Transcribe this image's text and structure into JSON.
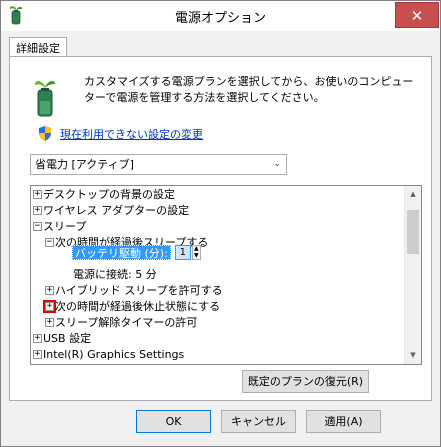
{
  "window": {
    "title": "電源オプション",
    "close_glyph": "✕"
  },
  "tab": {
    "label": "詳細設定"
  },
  "description": "カスタマイズする電源プランを選択してから、お使いのコンピューターで電源を管理する方法を選択してください。",
  "change_link": "現在利用できない設定の変更",
  "plan_select": {
    "value": "省電力 [アクティブ]",
    "arrow": "⌄"
  },
  "tree": {
    "items": [
      {
        "expander": "+",
        "label": "デスクトップの背景の設定"
      },
      {
        "expander": "+",
        "label": "ワイヤレス アダプターの設定"
      },
      {
        "expander": "−",
        "label": "スリープ"
      },
      {
        "expander": "−",
        "label": "次の時間が経過後スリープする"
      },
      {
        "expander": "",
        "label": "電源に接続: 5 分"
      },
      {
        "expander": "+",
        "label": "ハイブリッド スリープを許可する"
      },
      {
        "expander": "+",
        "label": "次の時間が経過後休止状態にする"
      },
      {
        "expander": "+",
        "label": "スリープ解除タイマーの許可"
      },
      {
        "expander": "+",
        "label": "USB 設定"
      },
      {
        "expander": "+",
        "label": "Intel(R) Graphics Settings"
      }
    ],
    "edit": {
      "label": "バッテリ駆動 (分):",
      "value": "1"
    }
  },
  "buttons": {
    "restore": "既定のプランの復元(R)",
    "ok": "OK",
    "cancel": "キャンセル",
    "apply": "適用(A)"
  },
  "icons": {
    "app": "battery-plant-icon",
    "shield": "uac-shield-icon"
  },
  "colors": {
    "close_button": "#c7504f",
    "link": "#0033cc",
    "selection": "#3399ff",
    "highlight_box": "#e00000"
  }
}
